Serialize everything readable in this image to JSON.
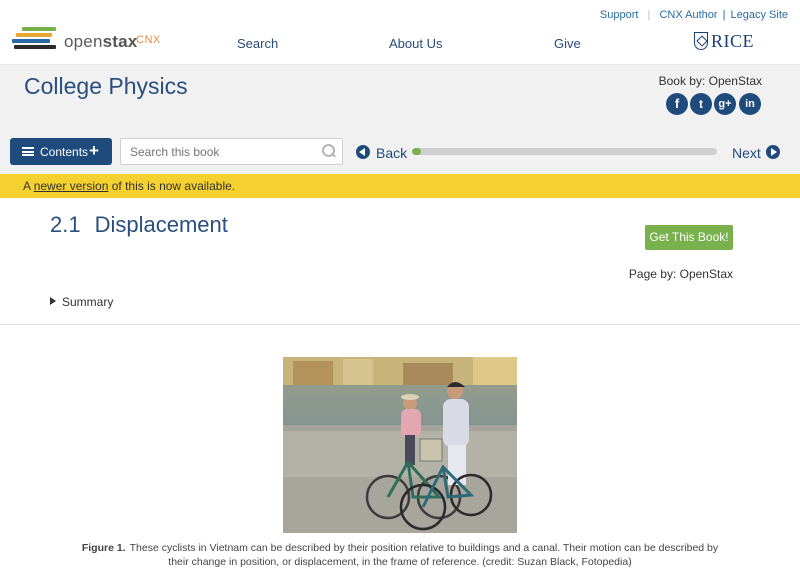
{
  "header": {
    "logo": {
      "word_light": "open",
      "word_bold": "stax",
      "suffix": "CNX"
    },
    "utility_links": {
      "support": "Support",
      "cnx_author": "CNX Author",
      "legacy_site": "Legacy Site"
    },
    "nav": {
      "search": "Search",
      "about_us": "About Us",
      "give": "Give"
    },
    "partner_logo": "RICE"
  },
  "book": {
    "title": "College Physics",
    "book_by": "Book by: OpenStax",
    "social": {
      "facebook": "f",
      "twitter": "t",
      "google_plus": "g+",
      "linkedin": "in"
    }
  },
  "toolbar": {
    "contents_label": "Contents",
    "search_placeholder": "Search this book",
    "back_label": "Back",
    "next_label": "Next",
    "progress_fraction": 0.03
  },
  "notice": {
    "prefix": "A ",
    "link_text": "newer version",
    "suffix": " of this is now available."
  },
  "page": {
    "section_number": "2.1",
    "section_title": "Displacement",
    "get_book_label": "Get This Book!",
    "page_by": "Page by: OpenStax",
    "summary_label": "Summary"
  },
  "figure": {
    "label": "Figure 1.",
    "caption_line1": "These cyclists in Vietnam can be described by their position relative to buildings and a canal. Their motion can be described by",
    "caption_line2": "their change in position, or displacement, in the frame of reference. (credit: Suzan Black, Fotopedia)"
  },
  "colors": {
    "brand_blue": "#1f4a7c",
    "title_blue": "#2a4f7e",
    "notice_yellow": "#f4d12e",
    "accent_green": "#79b24c",
    "header_gray": "#f1f1f1"
  }
}
